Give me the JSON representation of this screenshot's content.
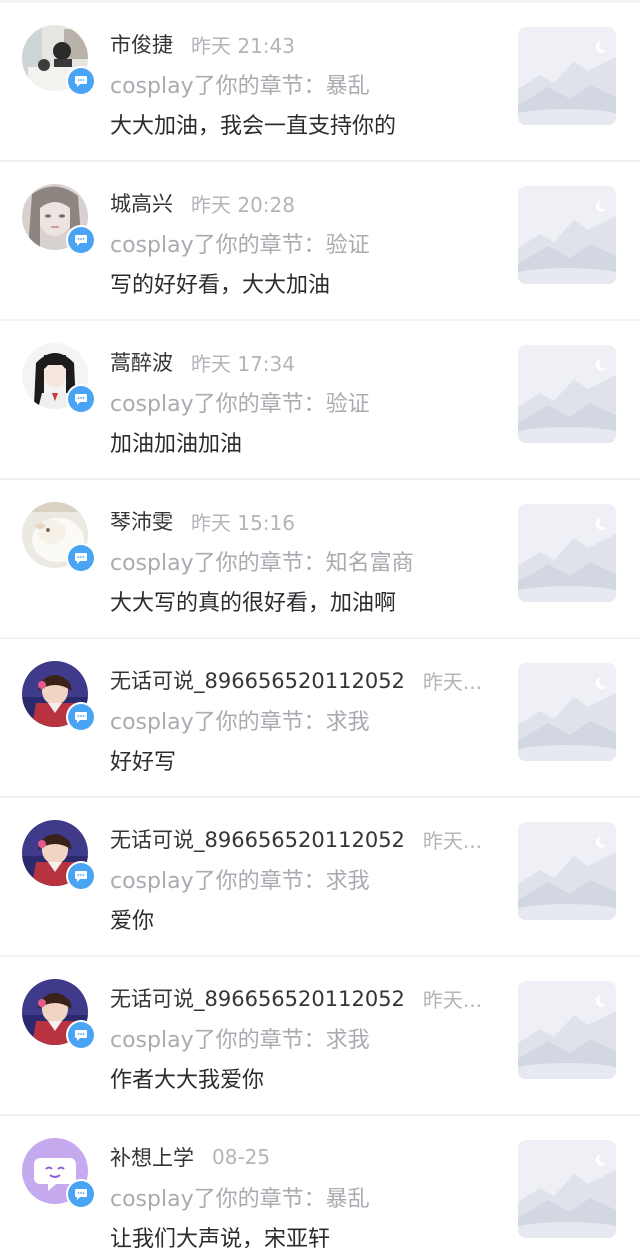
{
  "colors": {
    "badge": "#4aa4f4",
    "name": "#333538",
    "time": "#b3b5ba",
    "subline": "#a9abb1",
    "comment": "#2a2c30",
    "placeholder": "#eef0f5"
  },
  "items": [
    {
      "name": "市俊捷",
      "time": "昨天 21:43",
      "subline": "cosplay了你的章节：暴乱",
      "comment": "大大加油，我会一直支持你的",
      "avatar": "avatar-photo-room",
      "thumb": "image-placeholder-icon",
      "badge": "comment-icon"
    },
    {
      "name": "城高兴",
      "time": "昨天 20:28",
      "subline": "cosplay了你的章节：验证",
      "comment": "写的好好看，大大加油",
      "avatar": "avatar-photo-girl-blur",
      "thumb": "image-placeholder-icon",
      "badge": "comment-icon"
    },
    {
      "name": "蒿醉波",
      "time": "昨天 17:34",
      "subline": "cosplay了你的章节：验证",
      "comment": "加油加油加油",
      "avatar": "avatar-photo-girl-uniform",
      "thumb": "image-placeholder-icon",
      "badge": "comment-icon"
    },
    {
      "name": "琴沛雯",
      "time": "昨天 15:16",
      "subline": "cosplay了你的章节：知名富商",
      "comment": "大大写的真的很好看，加油啊",
      "avatar": "avatar-photo-lamb",
      "thumb": "image-placeholder-icon",
      "badge": "comment-icon"
    },
    {
      "name": "无话可说_896656520112052",
      "time": "昨天...",
      "subline": "cosplay了你的章节：求我",
      "comment": "好好写",
      "avatar": "avatar-photo-child",
      "thumb": "image-placeholder-icon",
      "badge": "comment-icon"
    },
    {
      "name": "无话可说_896656520112052",
      "time": "昨天...",
      "subline": "cosplay了你的章节：求我",
      "comment": "爱你",
      "avatar": "avatar-photo-child",
      "thumb": "image-placeholder-icon",
      "badge": "comment-icon"
    },
    {
      "name": "无话可说_896656520112052",
      "time": "昨天...",
      "subline": "cosplay了你的章节：求我",
      "comment": "作者大大我爱你",
      "avatar": "avatar-photo-child",
      "thumb": "image-placeholder-icon",
      "badge": "comment-icon"
    },
    {
      "name": "补想上学",
      "time": "08-25",
      "subline": "cosplay了你的章节：暴乱",
      "comment": "让我们大声说，宋亚轩",
      "avatar": "avatar-purple-chat",
      "thumb": "image-placeholder-icon",
      "badge": "comment-icon"
    }
  ]
}
